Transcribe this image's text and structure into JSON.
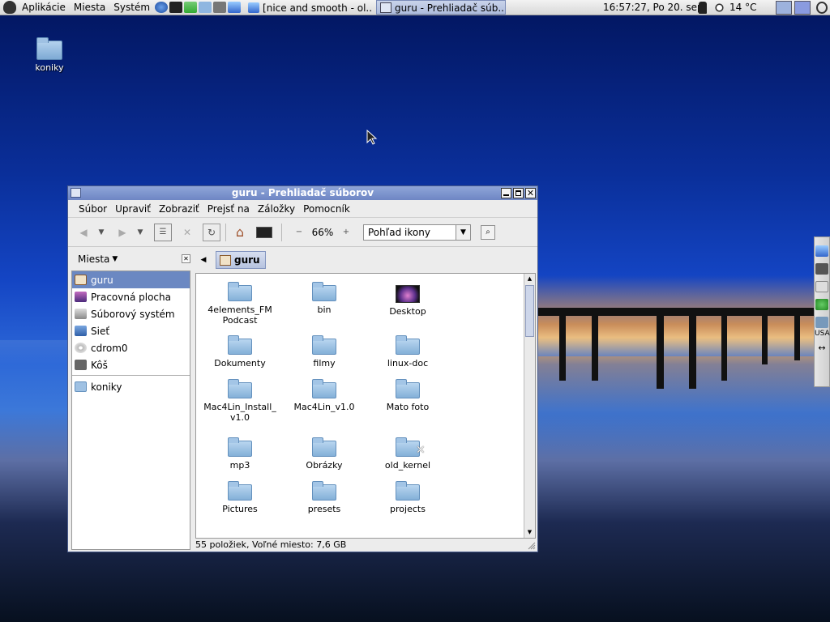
{
  "top_panel": {
    "menus": [
      "Aplikácie",
      "Miesta",
      "Systém"
    ],
    "tasks": [
      {
        "label": "[nice and smooth - ol..."
      },
      {
        "label": "guru - Prehliadač súb..."
      }
    ],
    "clock": "16:57:27, Po 20. sep",
    "temperature": "14 °C"
  },
  "desktop": {
    "icon_label": "koniky",
    "side_panel_layout": "USA"
  },
  "window": {
    "title": "guru - Prehliadač súborov",
    "menus": [
      "Súbor",
      "Upraviť",
      "Zobraziť",
      "Prejsť na",
      "Záložky",
      "Pomocník"
    ],
    "zoom": "66%",
    "view_mode": "Pohľad ikony",
    "places_title": "Miesta",
    "places": [
      "guru",
      "Pracovná plocha",
      "Súborový systém",
      "Sieť",
      "cdrom0",
      "Kôš"
    ],
    "bookmarks": [
      "koniky"
    ],
    "path_current": "guru",
    "items": [
      [
        "4elements_FM",
        "Podcast"
      ],
      [
        "bin"
      ],
      [
        "Desktop"
      ],
      [
        "Dokumenty"
      ],
      [
        "filmy"
      ],
      [
        "linux-doc"
      ],
      [
        "Mac4Lin_Install_",
        "v1.0"
      ],
      [
        "Mac4Lin_v1.0"
      ],
      [
        "Mato foto"
      ],
      [
        "mp3"
      ],
      [
        "Obrázky"
      ],
      [
        "old_kernel"
      ],
      [
        "Pictures"
      ],
      [
        "presets"
      ],
      [
        "projects"
      ]
    ],
    "status": "55 položiek, Voľné miesto: 7,6 GB"
  },
  "colors": {
    "title_blue": "#6e86c4",
    "selection": "#6b88c2"
  }
}
